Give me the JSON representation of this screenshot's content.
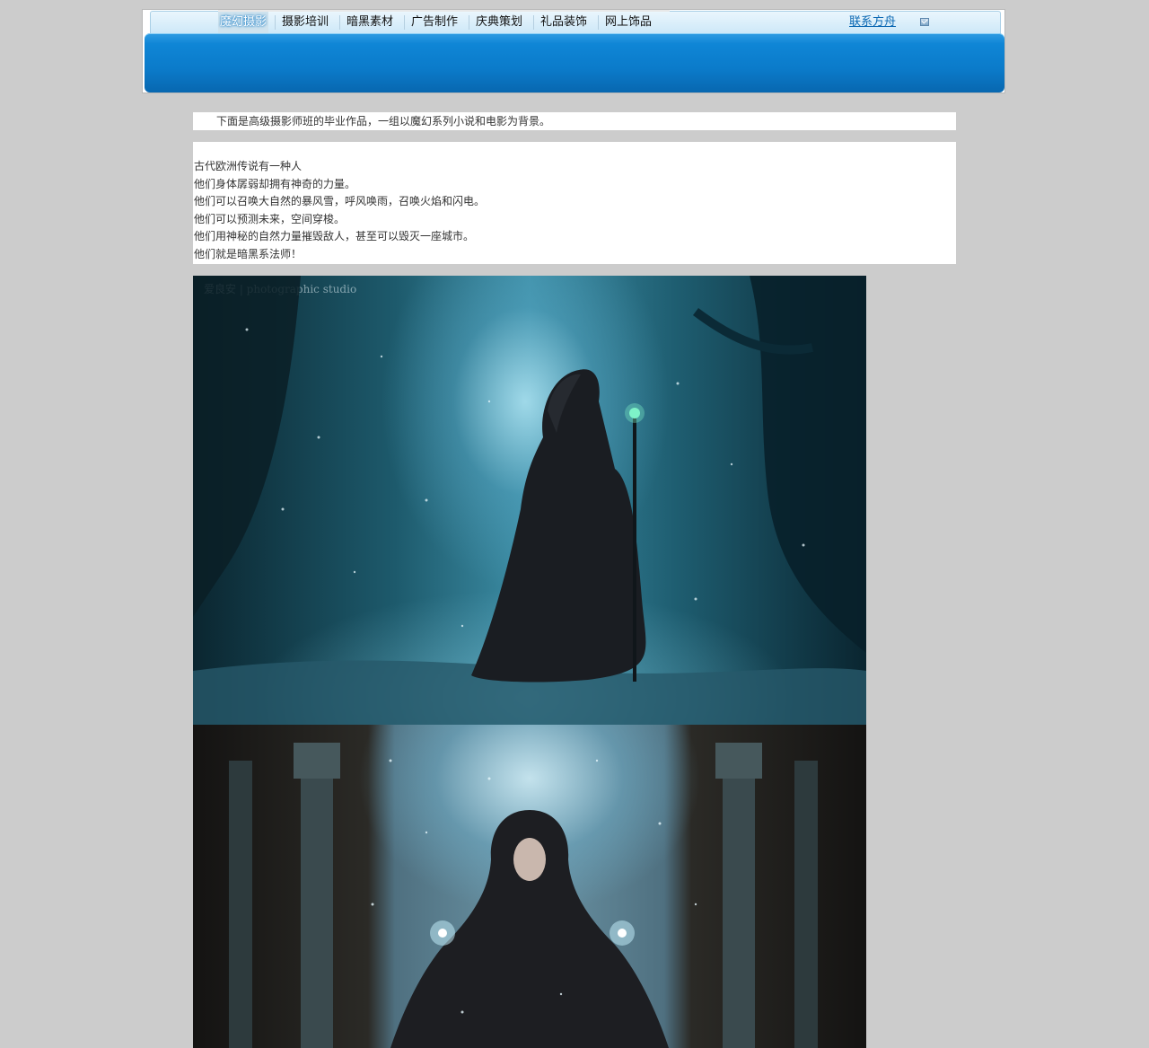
{
  "nav": {
    "items": [
      {
        "label": "魔幻摄影",
        "active": true
      },
      {
        "label": "摄影培训",
        "active": false
      },
      {
        "label": "暗黑素材",
        "active": false
      },
      {
        "label": "广告制作",
        "active": false
      },
      {
        "label": "庆典策划",
        "active": false
      },
      {
        "label": "礼品装饰",
        "active": false
      },
      {
        "label": "网上饰品",
        "active": false
      }
    ],
    "contact_label": "联系方舟",
    "contact_icon": "mail-icon"
  },
  "colors": {
    "page_background": "#cccccc",
    "banner_blue": "#0b7bca",
    "link_blue": "#0b68b3"
  },
  "intro": {
    "text": "下面是高级摄影师班的毕业作品，一组以魔幻系列小说和电影为背景。"
  },
  "story": {
    "lines": [
      "古代欧洲传说有一种人",
      "他们身体孱弱却拥有神奇的力量。",
      "他们可以召唤大自然的暴风雪，呼风唤雨，召唤火焰和闪电。",
      "他们可以预测未来，空间穿梭。",
      "他们用神秘的自然力量摧毁敌人，甚至可以毁灭一座城市。",
      "他们就是暗黑系法师！"
    ]
  },
  "photos": [
    {
      "subject": "hooded mage with staff in snowy blue forest",
      "watermark": "爱良安 | photographic studio"
    },
    {
      "subject": "hooded sorceress seated between stone pillars casting light"
    }
  ]
}
